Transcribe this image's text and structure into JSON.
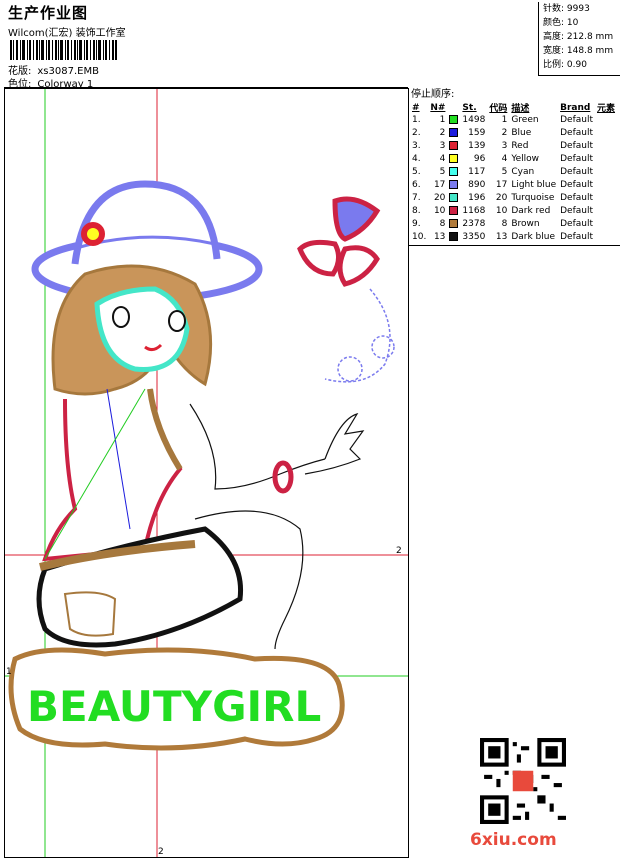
{
  "header": {
    "title": "生产作业图",
    "company": "Wilcom(汇宏) 装饰工作室",
    "design_label": "花版:",
    "design_value": "xs3087.EMB",
    "colorway_label": "色位:",
    "colorway_value": "Colorway 1"
  },
  "stats": [
    {
      "label": "针数:",
      "value": "9993"
    },
    {
      "label": "颜色:",
      "value": "10"
    },
    {
      "label": "高度:",
      "value": "212.8 mm"
    },
    {
      "label": "宽度:",
      "value": "148.8 mm"
    },
    {
      "label": "比例:",
      "value": "0.90"
    }
  ],
  "stop_sequence": {
    "title": "停止顺序:",
    "headers": [
      "#",
      "N#",
      "St.",
      "代码",
      "描述",
      "Brand",
      "元素"
    ],
    "rows": [
      {
        "idx": "1.",
        "n": "1",
        "color": "#22dd22",
        "st": "1498",
        "code": "1",
        "desc": "Green",
        "brand": "Default"
      },
      {
        "idx": "2.",
        "n": "2",
        "color": "#1b1bdd",
        "st": "159",
        "code": "2",
        "desc": "Blue",
        "brand": "Default"
      },
      {
        "idx": "3.",
        "n": "3",
        "color": "#dd2233",
        "st": "139",
        "code": "3",
        "desc": "Red",
        "brand": "Default"
      },
      {
        "idx": "4.",
        "n": "4",
        "color": "#ffff22",
        "st": "96",
        "code": "4",
        "desc": "Yellow",
        "brand": "Default"
      },
      {
        "idx": "5.",
        "n": "5",
        "color": "#44ffee",
        "st": "117",
        "code": "5",
        "desc": "Cyan",
        "brand": "Default"
      },
      {
        "idx": "6.",
        "n": "17",
        "color": "#7a7aee",
        "st": "890",
        "code": "17",
        "desc": "Light blue",
        "brand": "Default"
      },
      {
        "idx": "7.",
        "n": "20",
        "color": "#44e6c8",
        "st": "196",
        "code": "20",
        "desc": "Turquoise",
        "brand": "Default"
      },
      {
        "idx": "8.",
        "n": "10",
        "color": "#cc2244",
        "st": "1168",
        "code": "10",
        "desc": "Dark red",
        "brand": "Default"
      },
      {
        "idx": "9.",
        "n": "8",
        "color": "#b07a3a",
        "st": "2378",
        "code": "8",
        "desc": "Brown",
        "brand": "Default"
      },
      {
        "idx": "10.",
        "n": "13",
        "color": "#111111",
        "st": "3350",
        "code": "13",
        "desc": "Dark blue",
        "brand": "Default"
      }
    ]
  },
  "canvas": {
    "text_art": "BEAUTYGIRL",
    "axis_labels": {
      "h1": "2",
      "h2": "1",
      "v": "2"
    }
  },
  "watermark": "6xiu.com"
}
